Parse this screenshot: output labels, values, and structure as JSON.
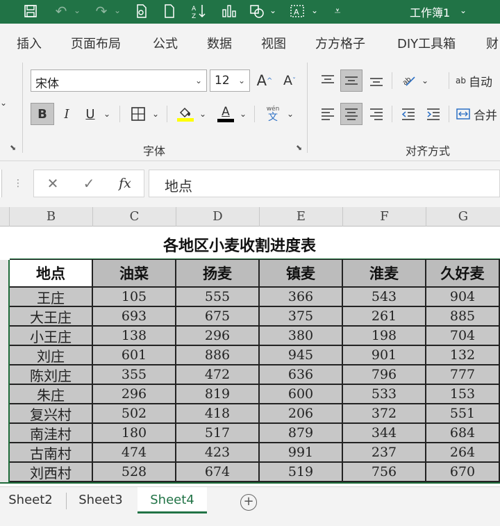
{
  "title_bar": {
    "workbook_title": "工作簿1"
  },
  "ribbon_tabs": [
    "插入",
    "页面布局",
    "公式",
    "数据",
    "视图",
    "方方格子",
    "DIY工具箱",
    "财"
  ],
  "font_group": {
    "font_name": "宋体",
    "font_size": "12",
    "bold": "B",
    "italic": "I",
    "underline": "U",
    "grow_font": "A",
    "shrink_font": "A",
    "font_color_letter": "A",
    "phonetic_top": "wén",
    "phonetic_bottom": "文",
    "label": "字体",
    "highlight_color": "#ffff00",
    "font_color": "#000000"
  },
  "alignment_group": {
    "wrap_text": "自动",
    "merge_center": "合并",
    "label": "对齐方式",
    "wrap_icon": "ab"
  },
  "formula_bar": {
    "cancel": "✕",
    "enter": "✓",
    "fx": "fx",
    "value": "地点"
  },
  "column_headers": [
    "B",
    "C",
    "D",
    "E",
    "F",
    "G"
  ],
  "sheet_title": "各地区小麦收割进度表",
  "table": {
    "headers": [
      "地点",
      "油菜",
      "扬麦",
      "镇麦",
      "淮麦",
      "久好麦"
    ],
    "rows": [
      [
        "王庄",
        "105",
        "555",
        "366",
        "543",
        "904"
      ],
      [
        "大王庄",
        "693",
        "675",
        "375",
        "261",
        "885"
      ],
      [
        "小王庄",
        "138",
        "296",
        "380",
        "198",
        "704"
      ],
      [
        "刘庄",
        "601",
        "886",
        "945",
        "901",
        "132"
      ],
      [
        "陈刘庄",
        "355",
        "472",
        "636",
        "796",
        "777"
      ],
      [
        "朱庄",
        "296",
        "819",
        "600",
        "533",
        "153"
      ],
      [
        "复兴村",
        "502",
        "418",
        "206",
        "372",
        "551"
      ],
      [
        "南洼村",
        "180",
        "517",
        "879",
        "344",
        "684"
      ],
      [
        "古南村",
        "474",
        "423",
        "991",
        "237",
        "264"
      ],
      [
        "刘西村",
        "528",
        "674",
        "519",
        "756",
        "670"
      ]
    ]
  },
  "sheet_tabs": [
    "Sheet2",
    "Sheet3",
    "Sheet4"
  ],
  "active_sheet": "Sheet4",
  "colors": {
    "excel_green": "#217346",
    "selection_fill": "#c7c7c7",
    "header_fill": "#bcbcbc"
  }
}
